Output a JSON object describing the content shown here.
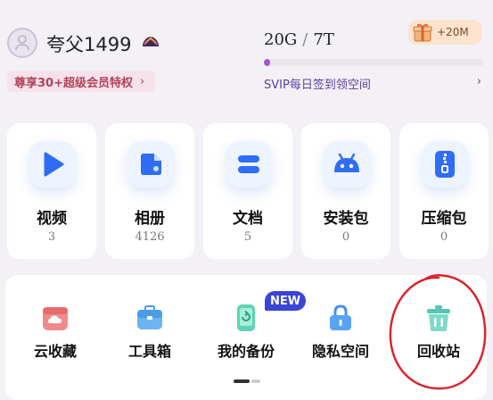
{
  "profile": {
    "username": "夸父1499"
  },
  "promo": {
    "svip_label": "尊享30+超级会员特权",
    "chevron": "›"
  },
  "storage": {
    "used": "20G",
    "separator": "/",
    "total": "7T",
    "usage_fraction": 0.003,
    "signin_text": "SVIP每日签到领空间",
    "chevron": "›"
  },
  "gift": {
    "label": "+20M"
  },
  "categories": [
    {
      "name": "视频",
      "count": "3",
      "icon": "play-icon"
    },
    {
      "name": "相册",
      "count": "4126",
      "icon": "photo-icon"
    },
    {
      "name": "文档",
      "count": "5",
      "icon": "document-icon"
    },
    {
      "name": "安装包",
      "count": "0",
      "icon": "android-icon"
    },
    {
      "name": "压缩包",
      "count": "0",
      "icon": "zip-icon"
    }
  ],
  "tools": [
    {
      "label": "云收藏",
      "icon": "cloud-favorite-icon"
    },
    {
      "label": "工具箱",
      "icon": "toolbox-icon"
    },
    {
      "label": "我的备份",
      "icon": "backup-icon"
    },
    {
      "label": "隐私空间",
      "icon": "lock-icon"
    },
    {
      "label": "回收站",
      "icon": "trash-icon"
    }
  ],
  "new_badge": "NEW",
  "colors": {
    "accent_blue": "#2f6df6",
    "progress": "#9b5bd3",
    "annotation_red": "#d8262e",
    "svip_pink": "#b1425d"
  }
}
